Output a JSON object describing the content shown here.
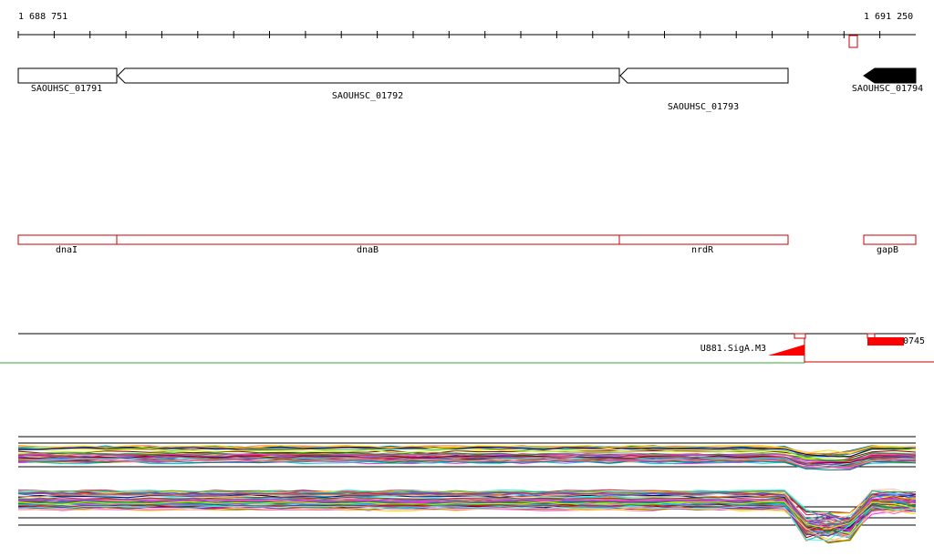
{
  "ruler": {
    "start_label": "1 688 751",
    "end_label": "1 691 250"
  },
  "genes": [
    {
      "name": "SAOUHSC_01791",
      "strand": "+",
      "filled": false
    },
    {
      "name": "SAOUHSC_01792",
      "strand": "-",
      "filled": false
    },
    {
      "name": "SAOUHSC_01793",
      "strand": "-",
      "filled": false
    },
    {
      "name": "SAOUHSC_01794",
      "strand": "-",
      "filled": true
    }
  ],
  "annotations": [
    {
      "name": "dnaI"
    },
    {
      "name": "dnaB"
    },
    {
      "name": "nrdR"
    },
    {
      "name": "gapB"
    }
  ],
  "features": {
    "promoter_label": "U881.SigA.M3",
    "right_label": "0745"
  },
  "colors": {
    "gene_outline": "#000000",
    "annotation_outline": "#cc0000",
    "feature_fill": "#ff0000",
    "divider_left": "#33aa33",
    "divider_right": "#cc0000"
  }
}
